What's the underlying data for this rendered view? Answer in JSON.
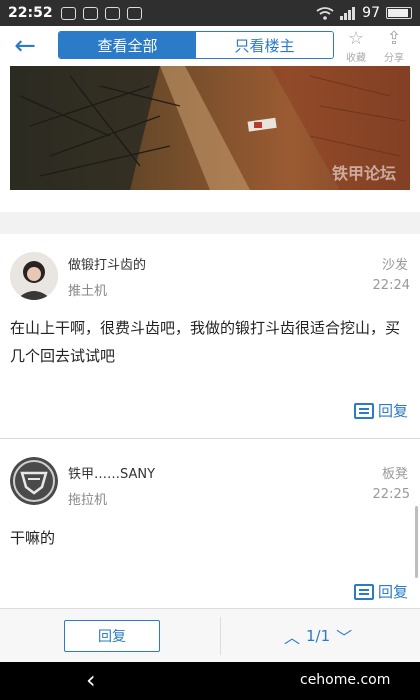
{
  "status_bar": {
    "time": "22:52",
    "battery": "97"
  },
  "topbar": {
    "back_label": "←",
    "tabs": [
      {
        "label": "查看全部"
      },
      {
        "label": "只看楼主"
      }
    ],
    "favorite_label": "收藏",
    "share_label": "分享"
  },
  "photo": {
    "watermark": "铁甲论坛"
  },
  "posts": [
    {
      "username": "做锻打斗齿的",
      "tag": "推土机",
      "floor": "沙发",
      "time": "22:24",
      "content": "在山上干啊，很费斗齿吧，我做的锻打斗齿很适合挖山，买几个回去试试吧",
      "reply_label": "回复"
    },
    {
      "username": "铁甲……SANY",
      "tag": "拖拉机",
      "floor": "板凳",
      "time": "22:25",
      "content": "干嘛的",
      "reply_label": "回复"
    }
  ],
  "bottom_bar": {
    "reply_label": "回复",
    "page": "1/1"
  },
  "navbar": {
    "watermark": "cehome.com"
  },
  "colors": {
    "accent": "#2b7bc8"
  }
}
